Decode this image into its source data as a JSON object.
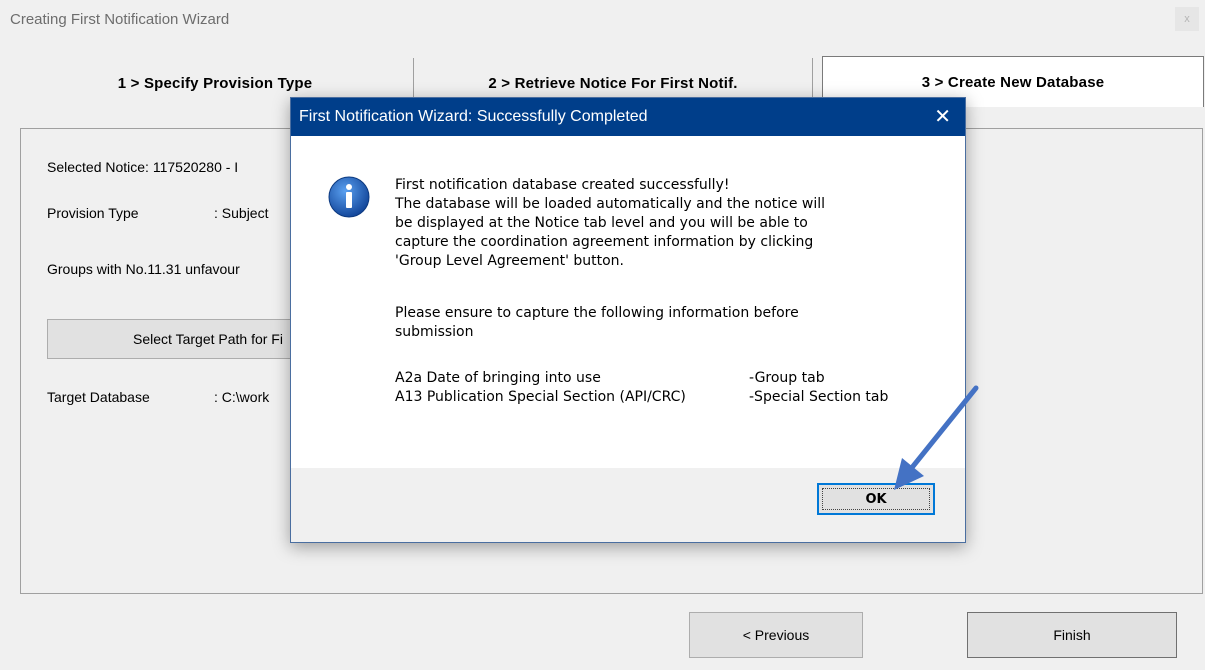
{
  "window": {
    "title": "Creating First Notification Wizard",
    "close_glyph": "x"
  },
  "steps": [
    {
      "label": "1 > Specify Provision Type"
    },
    {
      "label": "2 > Retrieve Notice For First Notif."
    },
    {
      "label": "3 > Create New Database"
    }
  ],
  "panel": {
    "selected_notice": "Selected Notice: 117520280 - I",
    "provision_type_label": "Provision Type",
    "provision_type_value": ": Subject",
    "groups_label": "Groups with No.11.31 unfavour",
    "select_target_button": "Select Target Path for Fi",
    "target_db_label": "Target Database",
    "target_db_value": ": C:\\work"
  },
  "nav": {
    "previous_label": "< Previous",
    "finish_label": "Finish"
  },
  "dialog": {
    "title": "First Notification Wizard: Successfully Completed",
    "close_glyph": "✕",
    "icon": "info-icon",
    "lines": [
      "First notification database created successfully!",
      "The database will be loaded automatically and the notice will",
      "be displayed at the Notice tab level and you will be able to",
      "capture the coordination agreement information by clicking",
      "'Group Level Agreement' button."
    ],
    "ensure_lines": [
      "Please ensure to capture the following information before",
      "submission"
    ],
    "items": [
      {
        "field": "A2a  Date of bringing into use",
        "tab": "-Group tab"
      },
      {
        "field": "A13 Publication Special Section (API/CRC)",
        "tab": "-Special Section tab"
      }
    ],
    "ok_label": "OK"
  },
  "colors": {
    "dialog_title_bar": "#003e8a",
    "info_icon": "#1a5fb4",
    "annotation_arrow": "#4472c4",
    "ok_focus_border": "#0078d7"
  }
}
